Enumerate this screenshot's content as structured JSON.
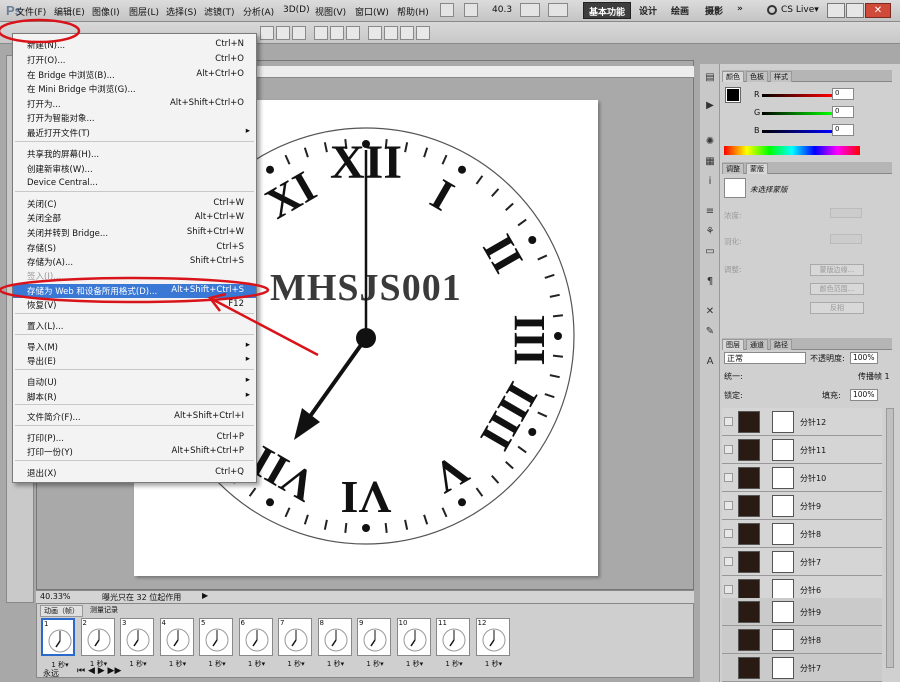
{
  "app": {
    "logo": "Ps"
  },
  "menubar": {
    "items": [
      "文件(F)",
      "编辑(E)",
      "图像(I)",
      "图层(L)",
      "选择(S)",
      "滤镜(T)",
      "分析(A)",
      "3D(D)",
      "视图(V)",
      "窗口(W)",
      "帮助(H)"
    ],
    "zoom": "40.3",
    "workspace": {
      "active": "基本功能",
      "others": [
        "设计",
        "绘画",
        "摄影"
      ],
      "more": "»"
    },
    "cslive": "CS Live▾"
  },
  "file_menu": {
    "items": [
      {
        "label": "新建(N)...",
        "shortcut": "Ctrl+N"
      },
      {
        "label": "打开(O)...",
        "shortcut": "Ctrl+O"
      },
      {
        "label": "在 Bridge 中浏览(B)...",
        "shortcut": "Alt+Ctrl+O"
      },
      {
        "label": "在 Mini Bridge 中浏览(G)...",
        "shortcut": ""
      },
      {
        "label": "打开为...",
        "shortcut": "Alt+Shift+Ctrl+O"
      },
      {
        "label": "打开为智能对象...",
        "shortcut": ""
      },
      {
        "label": "最近打开文件(T)",
        "shortcut": "",
        "arrow": "▸"
      },
      {
        "label": "共享我的屏幕(H)...",
        "shortcut": ""
      },
      {
        "label": "创建新审核(W)...",
        "shortcut": ""
      },
      {
        "label": "Device Central...",
        "shortcut": ""
      },
      {
        "label": "关闭(C)",
        "shortcut": "Ctrl+W"
      },
      {
        "label": "关闭全部",
        "shortcut": "Alt+Ctrl+W"
      },
      {
        "label": "关闭并转到 Bridge...",
        "shortcut": "Shift+Ctrl+W"
      },
      {
        "label": "存储(S)",
        "shortcut": "Ctrl+S"
      },
      {
        "label": "存储为(A)...",
        "shortcut": "Shift+Ctrl+S"
      },
      {
        "label": "签入(I)...",
        "shortcut": ""
      },
      {
        "label": "存储为 Web 和设备所用格式(D)...",
        "shortcut": "Alt+Shift+Ctrl+S"
      },
      {
        "label": "恢复(V)",
        "shortcut": "F12"
      },
      {
        "label": "置入(L)...",
        "shortcut": ""
      },
      {
        "label": "导入(M)",
        "shortcut": "",
        "arrow": "▸"
      },
      {
        "label": "导出(E)",
        "shortcut": "",
        "arrow": "▸"
      },
      {
        "label": "自动(U)",
        "shortcut": "",
        "arrow": "▸"
      },
      {
        "label": "脚本(R)",
        "shortcut": "",
        "arrow": "▸"
      },
      {
        "label": "文件简介(F)...",
        "shortcut": "Alt+Shift+Ctrl+I"
      },
      {
        "label": "打印(P)...",
        "shortcut": "Ctrl+P"
      },
      {
        "label": "打印一份(Y)",
        "shortcut": "Alt+Shift+Ctrl+P"
      },
      {
        "label": "退出(X)",
        "shortcut": "Ctrl+Q"
      }
    ]
  },
  "canvas": {
    "watermark": "MHSJS001"
  },
  "status": {
    "zoom": "40.33%",
    "message": "曝光只在 32 位起作用"
  },
  "animation": {
    "tabs": [
      "动画（帧）",
      "测量记录"
    ],
    "frames": [
      "1",
      "2",
      "3",
      "4",
      "5",
      "6",
      "7",
      "8",
      "9",
      "10",
      "11",
      "12"
    ],
    "delay": "1 秒▾",
    "loop": "永远"
  },
  "color_panel": {
    "tabs": [
      "颜色",
      "色板",
      "样式"
    ],
    "r_label": "R",
    "g_label": "G",
    "b_label": "B",
    "r": "0",
    "g": "0",
    "b": "0"
  },
  "adjust_panel": {
    "tabs": [
      "调整",
      "蒙版"
    ],
    "status": "未选择蒙版",
    "density": "浓度:",
    "feather": "羽化:",
    "refine": "调整:",
    "mask_edge": "蒙版边缘...",
    "color_range": "颜色范围...",
    "invert": "反相"
  },
  "layers_panel": {
    "tabs": [
      "图层",
      "通道",
      "路径"
    ],
    "blend_mode": "正常",
    "opacity_label": "不透明度:",
    "opacity": "100%",
    "unify": "统一:",
    "propagate": "传播帧 1",
    "lock": "锁定:",
    "fill_label": "填充:",
    "fill": "100%",
    "layers": [
      "分针12",
      "分针11",
      "分针10",
      "分针9",
      "分针8",
      "分针7",
      "分针6"
    ],
    "layers_lower": [
      "分针9",
      "分针8",
      "分针7"
    ]
  }
}
